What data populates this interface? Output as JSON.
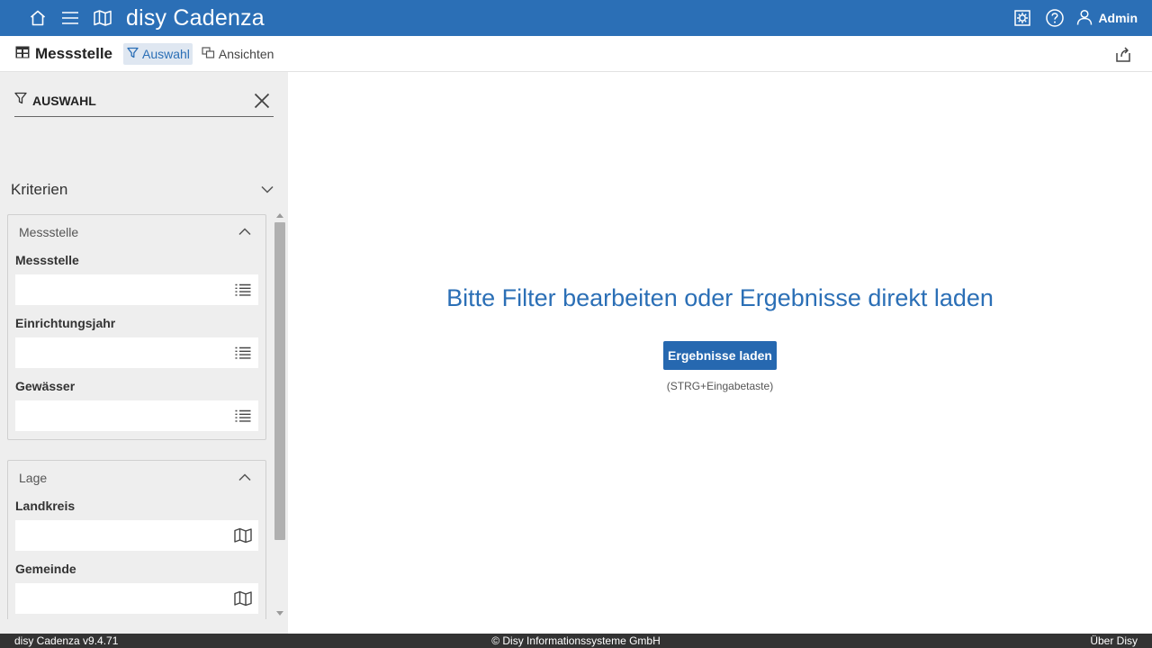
{
  "app": {
    "brand": "disy Cadenza",
    "user": "Admin",
    "accent_color": "#2b6fb6"
  },
  "icons": {
    "home": "home-icon",
    "menu": "menu-icon",
    "map": "map-icon",
    "settings": "settings-icon",
    "help": "help-icon",
    "user": "user-icon",
    "table": "table-icon",
    "filter": "filter-icon",
    "views": "views-icon",
    "share": "share-icon",
    "close": "close-icon",
    "list": "list-icon"
  },
  "toolbar": {
    "title": "Messstelle",
    "tabs": [
      {
        "label": "Auswahl",
        "active": true
      },
      {
        "label": "Ansichten",
        "active": false
      }
    ]
  },
  "sidebar": {
    "panel_title": "AUSWAHL",
    "criteria_label": "Kriterien",
    "groups": [
      {
        "name": "Messstelle",
        "fields": [
          {
            "label": "Messstelle",
            "value": "",
            "icon": "list-icon"
          },
          {
            "label": "Einrichtungsjahr",
            "value": "",
            "icon": "list-icon"
          },
          {
            "label": "Gewässer",
            "value": "",
            "icon": "list-icon"
          }
        ]
      },
      {
        "name": "Lage",
        "fields": [
          {
            "label": "Landkreis",
            "value": "",
            "icon": "map-icon"
          },
          {
            "label": "Gemeinde",
            "value": "",
            "icon": "map-icon"
          }
        ]
      }
    ]
  },
  "main": {
    "headline": "Bitte Filter bearbeiten oder Ergebnisse direkt laden",
    "button_label": "Ergebnisse laden",
    "hint": "(STRG+Eingabetaste)"
  },
  "footer": {
    "version": "disy Cadenza v9.4.71",
    "copyright": "© Disy Informationssysteme GmbH",
    "about": "Über Disy"
  }
}
